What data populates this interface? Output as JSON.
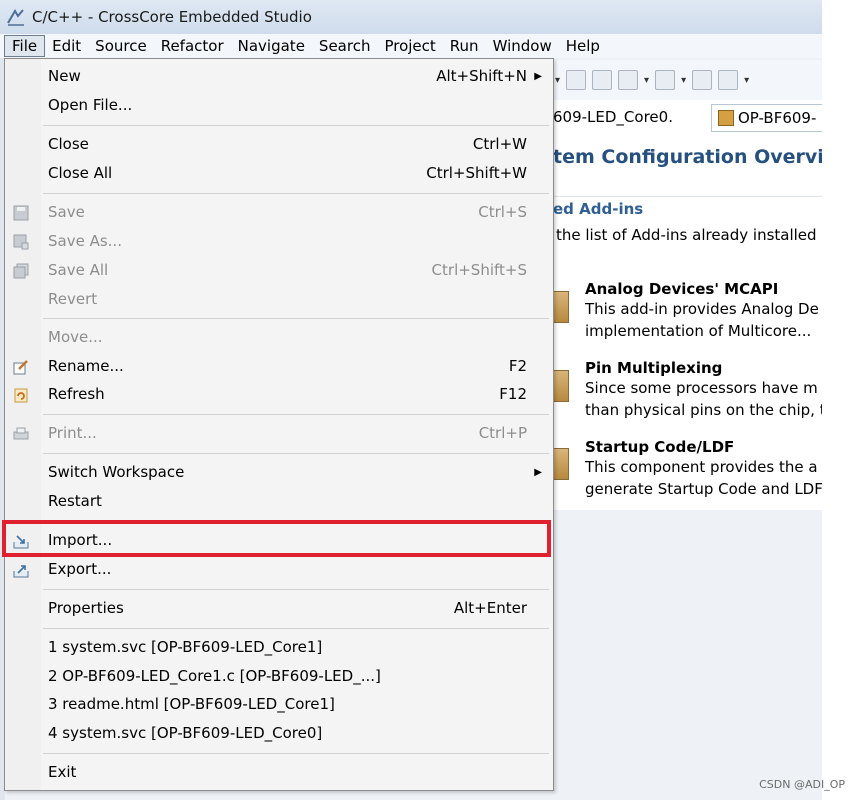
{
  "window": {
    "title": "C/C++ - CrossCore Embedded Studio"
  },
  "menubar": [
    "File",
    "Edit",
    "Source",
    "Refactor",
    "Navigate",
    "Search",
    "Project",
    "Run",
    "Window",
    "Help"
  ],
  "file_menu": {
    "items": [
      {
        "label": "New",
        "shortcut": "Alt+Shift+N",
        "submenu": true,
        "disabled": false
      },
      {
        "label": "Open File...",
        "shortcut": "",
        "disabled": false
      },
      {
        "label": "Close",
        "shortcut": "Ctrl+W",
        "disabled": false
      },
      {
        "label": "Close All",
        "shortcut": "Ctrl+Shift+W",
        "disabled": false
      },
      {
        "label": "Save",
        "shortcut": "Ctrl+S",
        "disabled": true,
        "icon": "save-icon"
      },
      {
        "label": "Save As...",
        "shortcut": "",
        "disabled": true,
        "icon": "save-as-icon"
      },
      {
        "label": "Save All",
        "shortcut": "Ctrl+Shift+S",
        "disabled": true,
        "icon": "save-all-icon"
      },
      {
        "label": "Revert",
        "shortcut": "",
        "disabled": true
      },
      {
        "label": "Move...",
        "shortcut": "",
        "disabled": true
      },
      {
        "label": "Rename...",
        "shortcut": "F2",
        "disabled": false,
        "icon": "rename-icon"
      },
      {
        "label": "Refresh",
        "shortcut": "F12",
        "disabled": false,
        "icon": "refresh-icon"
      },
      {
        "label": "Print...",
        "shortcut": "Ctrl+P",
        "disabled": true,
        "icon": "print-icon"
      },
      {
        "label": "Switch Workspace",
        "shortcut": "",
        "submenu": true,
        "disabled": false
      },
      {
        "label": "Restart",
        "shortcut": "",
        "disabled": false
      },
      {
        "label": "Import...",
        "shortcut": "",
        "disabled": false,
        "icon": "import-icon"
      },
      {
        "label": "Export...",
        "shortcut": "",
        "disabled": false,
        "icon": "export-icon"
      },
      {
        "label": "Properties",
        "shortcut": "Alt+Enter",
        "disabled": false
      },
      {
        "label": "1 system.svc  [OP-BF609-LED_Core1]",
        "shortcut": "",
        "disabled": false
      },
      {
        "label": "2 OP-BF609-LED_Core1.c  [OP-BF609-LED_...]",
        "shortcut": "",
        "disabled": false
      },
      {
        "label": "3 readme.html  [OP-BF609-LED_Core1]",
        "shortcut": "",
        "disabled": false
      },
      {
        "label": "4 system.svc  [OP-BF609-LED_Core0]",
        "shortcut": "",
        "disabled": false
      },
      {
        "label": "Exit",
        "shortcut": "",
        "disabled": false
      }
    ]
  },
  "editor_tabs": [
    "609-LED_Core0.",
    "OP-BF609-"
  ],
  "overview": {
    "title": "tem Configuration Overview",
    "section_title": "ed Add-ins",
    "section_desc": "the list of Add-ins already installed",
    "addins": [
      {
        "title": "Analog Devices' MCAPI",
        "line1": "This add-in provides Analog De",
        "line2": "implementation of Multicore..."
      },
      {
        "title": "Pin Multiplexing",
        "line1": "Since some processors have m",
        "line2": "than physical pins on the chip, t"
      },
      {
        "title": "Startup Code/LDF",
        "line1": "This component provides the a",
        "line2": "generate Startup Code and LDF"
      }
    ]
  },
  "watermark": "CSDN @ADI_OP",
  "colors": {
    "highlight": "#e0202e",
    "accent": "#25507f"
  }
}
